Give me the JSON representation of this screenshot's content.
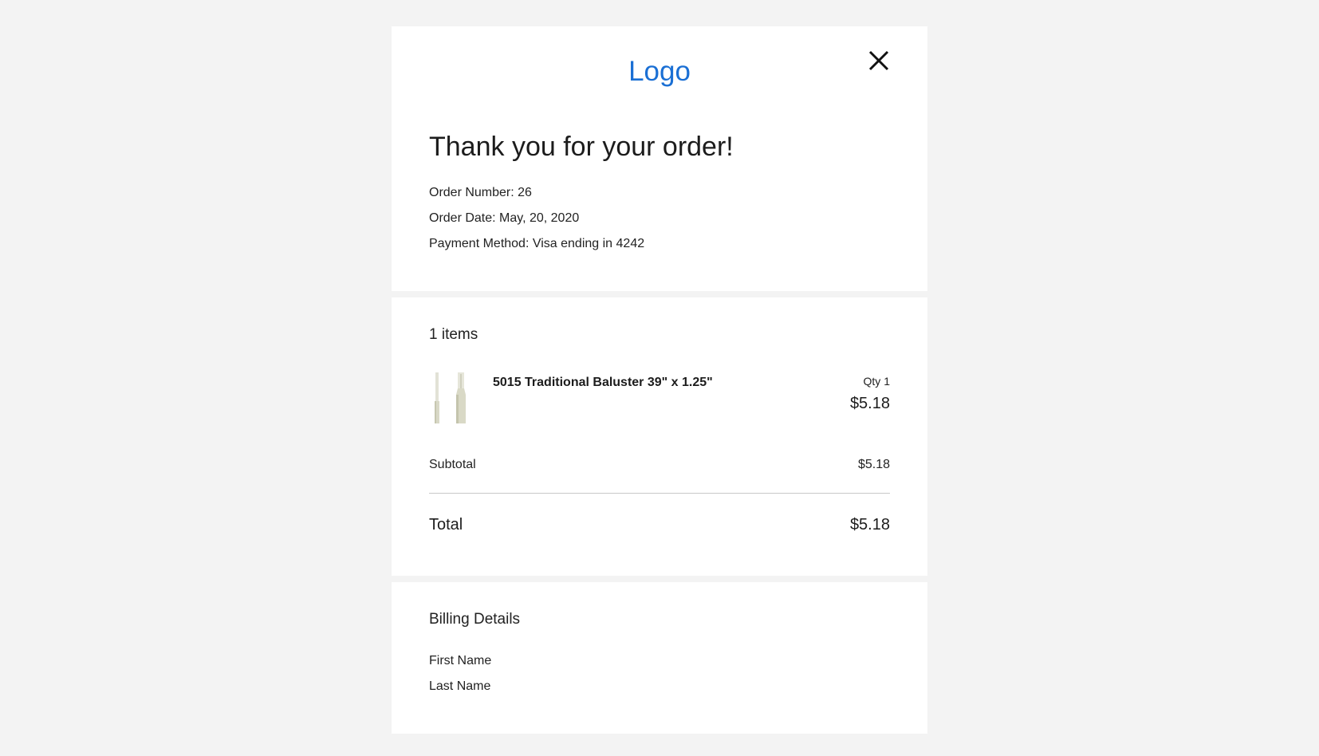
{
  "header": {
    "logo_text": "Logo",
    "close_icon": "close-icon",
    "title": "Thank you for your order!",
    "order_number": "Order Number: 26",
    "order_date": "Order Date: May, 20, 2020",
    "payment_method": "Payment Method: Visa ending in 4242"
  },
  "items": {
    "count_label": "1 items",
    "list": [
      {
        "name": "5015 Traditional Baluster 39\" x 1.25\"",
        "qty": "Qty 1",
        "price": "$5.18"
      }
    ],
    "subtotal_label": "Subtotal",
    "subtotal_value": "$5.18",
    "total_label": "Total",
    "total_value": "$5.18"
  },
  "billing": {
    "title": "Billing Details",
    "first_name_label": "First Name",
    "last_name_label": "Last Name"
  },
  "colors": {
    "accent": "#1a6fd4",
    "background": "#f3f3f3",
    "card": "#ffffff"
  }
}
